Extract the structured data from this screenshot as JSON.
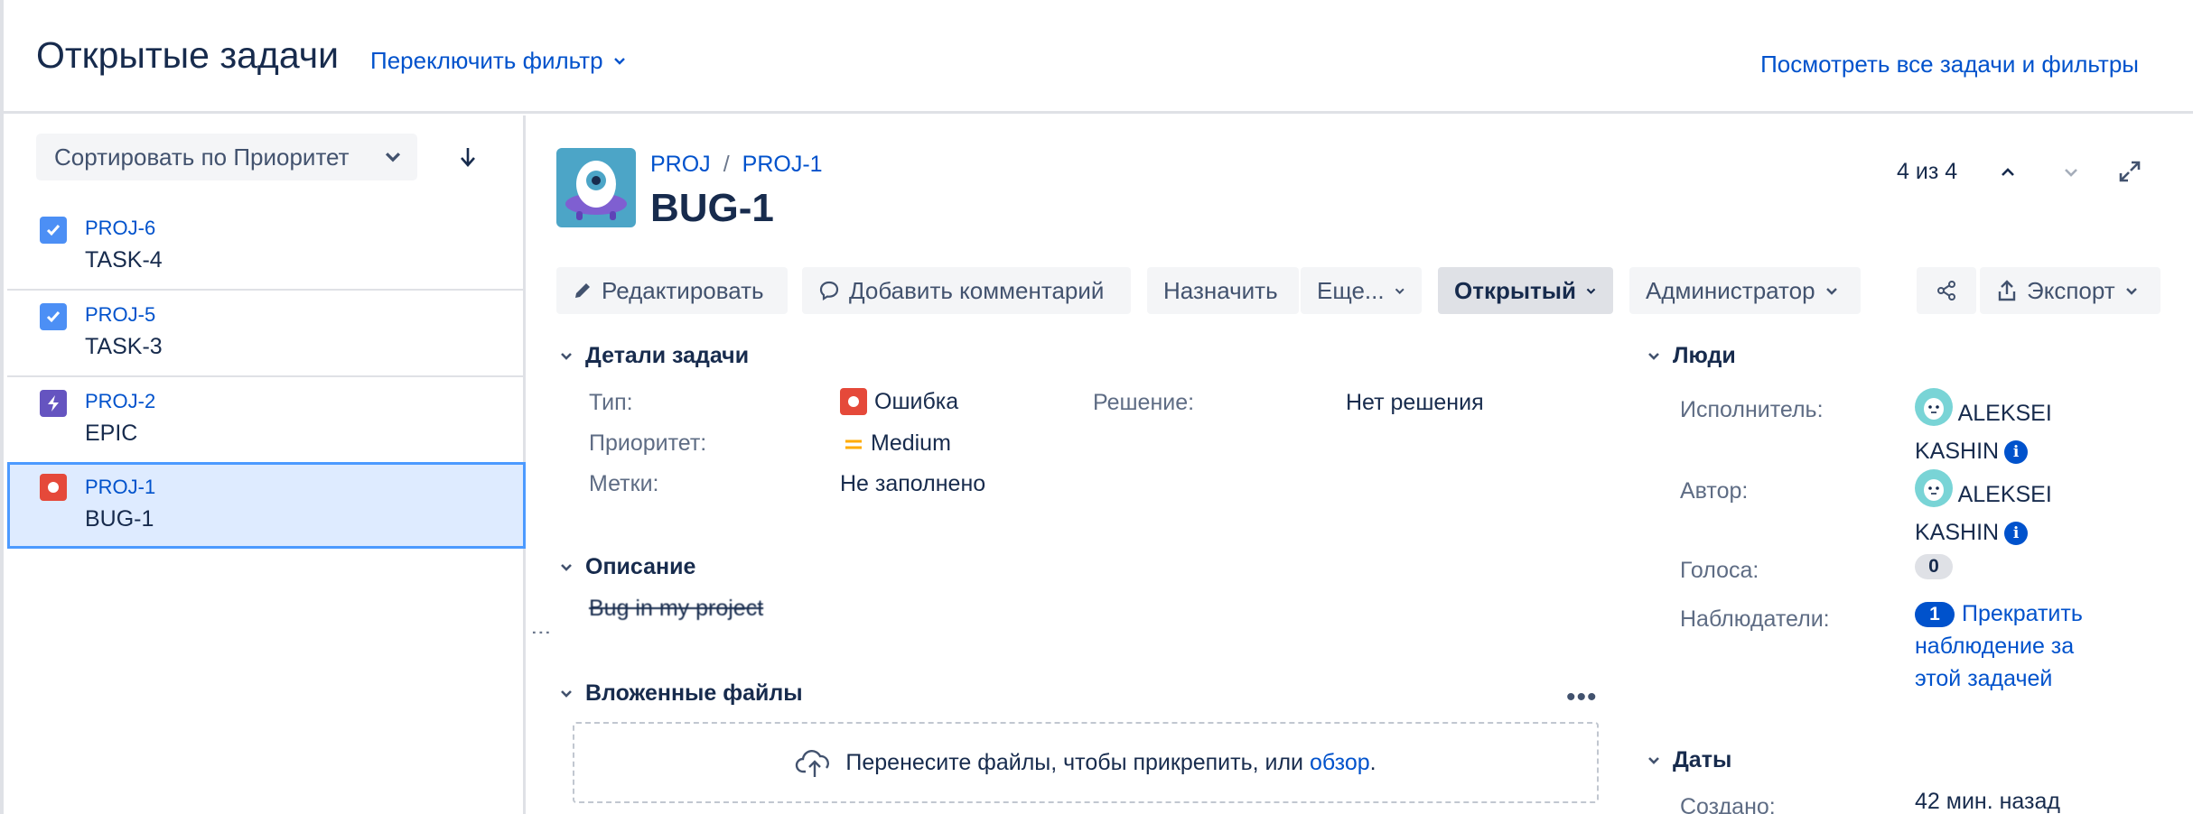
{
  "header": {
    "title": "Открытые задачи",
    "filter_switch": "Переключить фильтр",
    "view_all": "Посмотреть все задачи и фильтры"
  },
  "sidebar": {
    "sort_label": "Сортировать по Приоритет",
    "items": [
      {
        "key": "PROJ-6",
        "summary": "TASK-4",
        "type": "task",
        "selected": false
      },
      {
        "key": "PROJ-5",
        "summary": "TASK-3",
        "type": "task",
        "selected": false
      },
      {
        "key": "PROJ-2",
        "summary": "EPIC",
        "type": "epic",
        "selected": true
      },
      {
        "key": "PROJ-1",
        "summary": "BUG-1",
        "type": "bug",
        "selected": true
      }
    ]
  },
  "issue": {
    "project": "PROJ",
    "key": "PROJ-1",
    "title": "BUG-1",
    "pager": "4 из 4"
  },
  "toolbar": {
    "edit": "Редактировать",
    "comment": "Добавить комментарий",
    "assign": "Назначить",
    "more": "Еще...",
    "status": "Открытый",
    "admin": "Администратор",
    "export": "Экспорт"
  },
  "details": {
    "heading": "Детали задачи",
    "type_label": "Тип:",
    "type_value": "Ошибка",
    "priority_label": "Приоритет:",
    "priority_value": "Medium",
    "labels_label": "Метки:",
    "labels_value": "Не заполнено",
    "resolution_label": "Решение:",
    "resolution_value": "Нет решения"
  },
  "description": {
    "heading": "Описание",
    "text": "Bug in my project"
  },
  "attachments": {
    "heading": "Вложенные файлы",
    "drop_text": "Перенесите файлы, чтобы прикрепить, или",
    "browse": "обзор",
    "drop_suffix": "."
  },
  "people": {
    "heading": "Люди",
    "assignee_label": "Исполнитель:",
    "assignee_first": "ALEKSEI",
    "assignee_last": "KASHIN",
    "reporter_label": "Автор:",
    "reporter_first": "ALEKSEI",
    "reporter_last": "KASHIN",
    "votes_label": "Голоса:",
    "votes": "0",
    "watchers_label": "Наблюдатели:",
    "watchers_count": "1",
    "watch_action": "Прекратить наблюдение за этой задачей"
  },
  "dates": {
    "heading": "Даты",
    "created_label": "Создано:",
    "created_value": "42 мин. назад"
  },
  "colors": {
    "accent": "#0052cc",
    "task": "#4bade8",
    "epic": "#904ee2",
    "bug": "#e5493a",
    "priority_medium": "#ffab00"
  }
}
